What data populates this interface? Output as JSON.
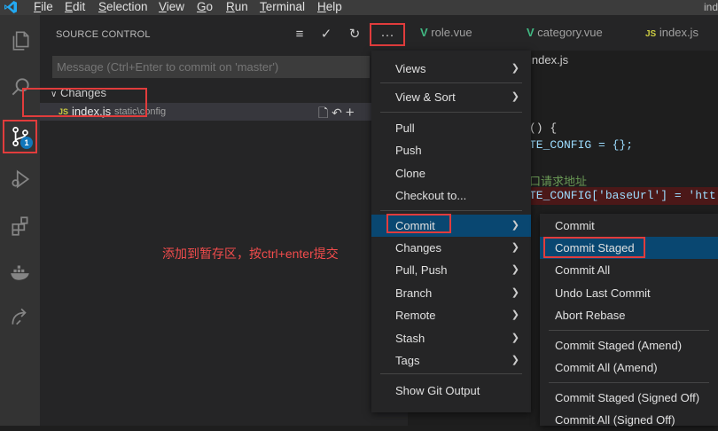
{
  "menubar": {
    "items": [
      {
        "u": "F",
        "rest": "ile"
      },
      {
        "u": "E",
        "rest": "dit"
      },
      {
        "u": "S",
        "rest": "election"
      },
      {
        "u": "V",
        "rest": "iew"
      },
      {
        "u": "G",
        "rest": "o"
      },
      {
        "u": "R",
        "rest": "un"
      },
      {
        "u": "T",
        "rest": "erminal"
      },
      {
        "u": "H",
        "rest": "elp"
      }
    ],
    "window_title": "ind"
  },
  "activity": {
    "scm_badge": "1",
    "icons": [
      "explorer-icon",
      "search-icon",
      "source-control-icon",
      "run-debug-icon",
      "extensions-icon",
      "docker-icon",
      "remote-icon"
    ]
  },
  "sidebar": {
    "title": "SOURCE CONTROL",
    "message_placeholder": "Message (Ctrl+Enter to commit on 'master')",
    "changes_label": "Changes",
    "file": {
      "type_tag": "JS",
      "name": "index.js",
      "path": "static\\config"
    },
    "annotation": "添加到暂存区，按ctrl+enter提交"
  },
  "tabs": [
    {
      "icon": "V",
      "label": "role.vue"
    },
    {
      "icon": "V",
      "label": "category.vue"
    },
    {
      "icon": "JS",
      "label": "index.js"
    }
  ],
  "editor": {
    "breadcrumb": "index.js",
    "lines": [
      {
        "text": "() {",
        "color": "#d4d4d4"
      },
      {
        "text": "TE_CONFIG = {};",
        "color": "#9cdcfe"
      },
      {
        "text": "口请求地址",
        "color": "#6a9955"
      },
      {
        "text": "TE_CONFIG['baseUrl'] = 'htt",
        "color": "#9cdcfe"
      }
    ]
  },
  "context_menu": {
    "items": [
      {
        "label": "Views",
        "submenu": true
      },
      {
        "label": "View & Sort",
        "submenu": true
      },
      {
        "label": "Pull",
        "submenu": false
      },
      {
        "label": "Push",
        "submenu": false
      },
      {
        "label": "Clone",
        "submenu": false
      },
      {
        "label": "Checkout to...",
        "submenu": false
      },
      {
        "label": "Commit",
        "submenu": true
      },
      {
        "label": "Changes",
        "submenu": true
      },
      {
        "label": "Pull, Push",
        "submenu": true
      },
      {
        "label": "Branch",
        "submenu": true
      },
      {
        "label": "Remote",
        "submenu": true
      },
      {
        "label": "Stash",
        "submenu": true
      },
      {
        "label": "Tags",
        "submenu": true
      },
      {
        "label": "Show Git Output",
        "submenu": false
      }
    ],
    "selected": "Commit"
  },
  "commit_submenu": {
    "items": [
      "Commit",
      "Commit Staged",
      "Commit All",
      "Undo Last Commit",
      "Abort Rebase",
      "Commit Staged (Amend)",
      "Commit All (Amend)",
      "Commit Staged (Signed Off)",
      "Commit All (Signed Off)"
    ],
    "selected": "Commit Staged"
  },
  "colors": {
    "highlight_box": "#e13c3c",
    "selection": "#094771",
    "accent_badge": "#1177bb",
    "annotation_text": "#f14c4c"
  }
}
